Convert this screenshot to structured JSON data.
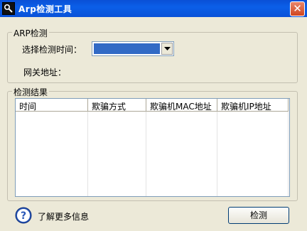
{
  "window": {
    "title": "Arp检测工具",
    "close_label": "✕"
  },
  "arp_group": {
    "legend": "ARP检测",
    "time_label": "选择检测时间：",
    "time_value": "",
    "gateway_label": "网关地址："
  },
  "results_group": {
    "legend": "检测结果",
    "columns": [
      "时间",
      "欺骗方式",
      "欺骗机MAC地址",
      "欺骗机IP地址"
    ]
  },
  "footer": {
    "help_text": "了解更多信息",
    "detect_button": "检测"
  }
}
